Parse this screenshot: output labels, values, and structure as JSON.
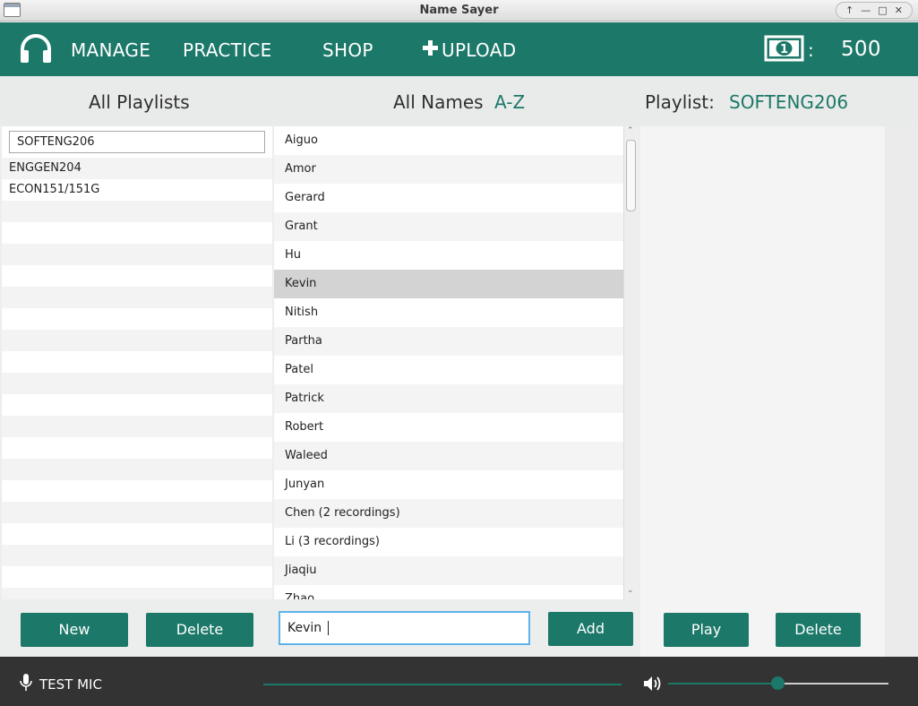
{
  "window": {
    "title": "Name Sayer"
  },
  "nav": {
    "manage": "MANAGE",
    "practice": "PRACTICE",
    "shop": "SHOP",
    "upload": "UPLOAD",
    "currency_separator": ":",
    "balance": "500"
  },
  "headers": {
    "all_playlists": "All Playlists",
    "all_names": "All Names",
    "sort": "A-Z",
    "playlist_label": "Playlist:",
    "playlist_name": "SOFTENG206"
  },
  "playlists": {
    "input_value": "SOFTENG206",
    "items": [
      "ENGGEN204",
      "ECON151/151G"
    ]
  },
  "names": {
    "items": [
      "Aiguo",
      "Amor",
      "Gerard",
      "Grant",
      "Hu",
      "Kevin",
      "Nitish",
      "Partha",
      "Patel",
      "Patrick",
      "Robert",
      "Waleed",
      "Junyan",
      "Chen (2 recordings)",
      "Li (3 recordings)",
      "Jiaqiu",
      "Zhao"
    ],
    "selected": "Kevin",
    "input_value": "Kevin "
  },
  "buttons": {
    "new": "New",
    "delete_playlist": "Delete",
    "add": "Add",
    "play": "Play",
    "delete_name": "Delete"
  },
  "bottom": {
    "test_mic": "TEST MIC",
    "volume_fraction": 0.5
  },
  "colors": {
    "accent": "#1c7868",
    "bottom_bar": "#333333"
  },
  "icons": {
    "logo": "headphones-icon",
    "upload": "plus-icon",
    "currency": "banknote-icon",
    "mic": "microphone-icon",
    "volume": "speaker-icon"
  }
}
